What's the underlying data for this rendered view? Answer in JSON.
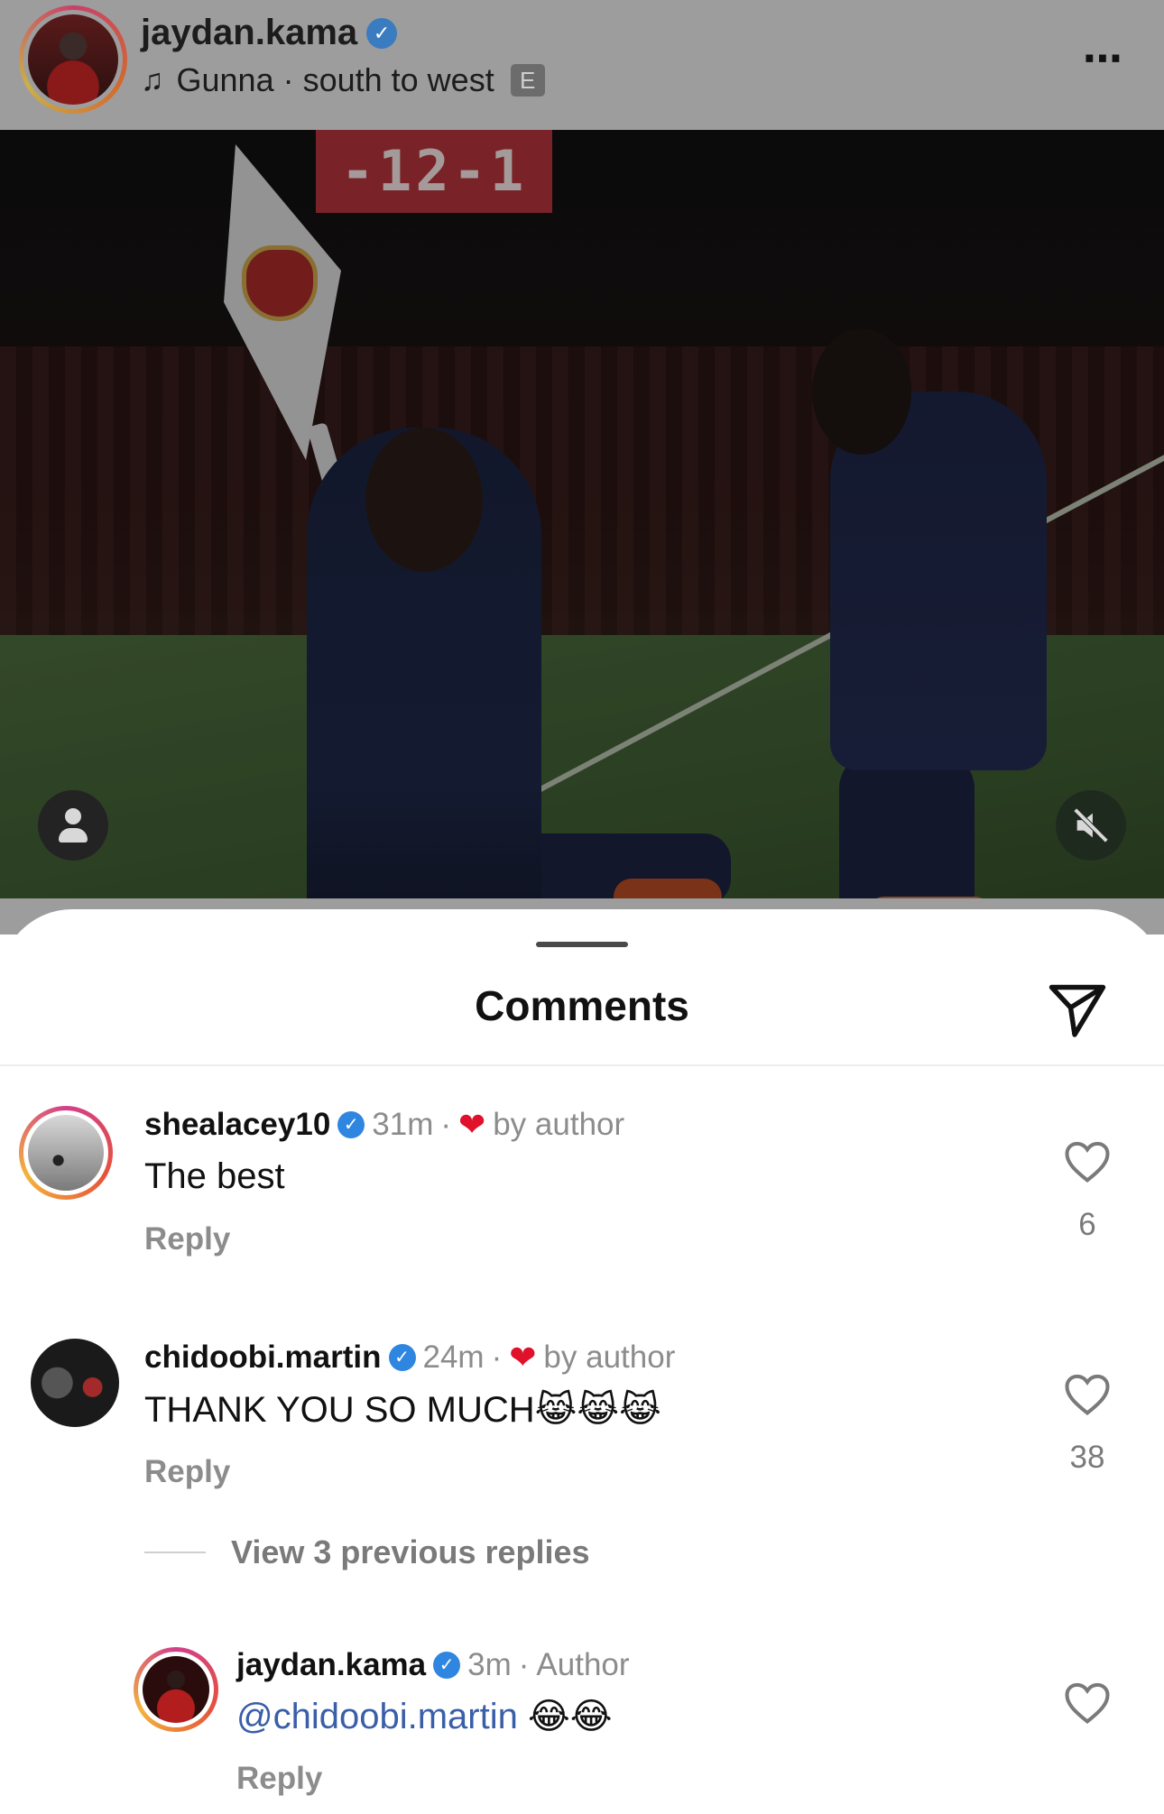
{
  "post": {
    "username": "jaydan.kama",
    "verified_mark": "✓",
    "audio": "Gunna · south to west",
    "explicit_badge": "E",
    "more_icon": "⋯"
  },
  "media": {
    "scoreboard": "-12-1",
    "tag_icon": "person-icon",
    "mute_icon": "speaker-muted-icon"
  },
  "comments_sheet": {
    "title": "Comments",
    "share_icon": "paper-plane-icon"
  },
  "comments": [
    {
      "username": "shealacey10",
      "time": "31m",
      "liked_by": "by author",
      "text": "The best",
      "reply": "Reply",
      "likes": "6"
    },
    {
      "username": "chidoobi.martin",
      "time": "24m",
      "liked_by": "by author",
      "text": "THANK YOU SO MUCH😹😹😹",
      "reply": "Reply",
      "likes": "38"
    }
  ],
  "view_replies": "View 3 previous replies",
  "reply_comment": {
    "username": "jaydan.kama",
    "time": "3m",
    "role": "Author",
    "mention": "@chidoobi.martin",
    "emojis": " 😂😂",
    "reply": "Reply"
  },
  "colors": {
    "verified": "#2f86e0",
    "heart": "#e0112b",
    "mention": "#3a5ea8"
  }
}
